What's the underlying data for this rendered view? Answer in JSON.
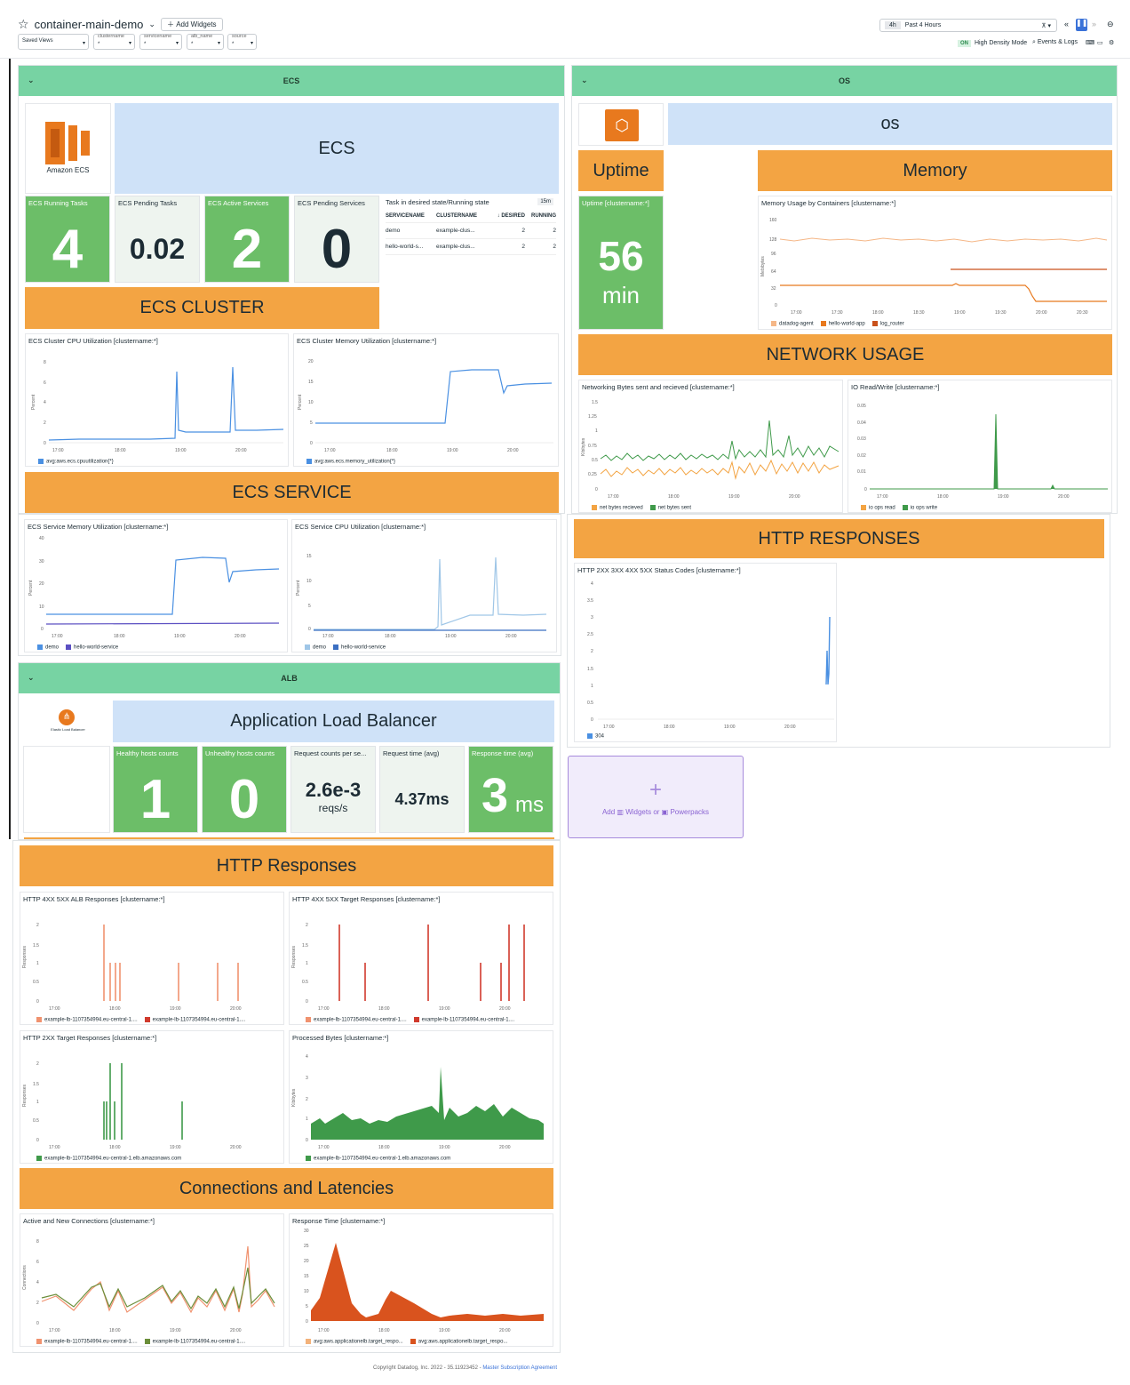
{
  "header": {
    "dashboard_title": "container-main-demo",
    "add_widgets": "Add Widgets",
    "saved_views": "Saved Views",
    "vars": [
      {
        "name": "clustername",
        "value": "*"
      },
      {
        "name": "servicename",
        "value": "*"
      },
      {
        "name": "alb_name",
        "value": "*"
      },
      {
        "name": "source",
        "value": "*"
      }
    ],
    "time_short": "4h",
    "time_label": "Past 4 Hours",
    "on_badge": "ON",
    "high_density": "High Density Mode",
    "events_logs": "Events & Logs"
  },
  "ecs": {
    "group_title": "ECS",
    "logo_text": "Amazon ECS",
    "note": "ECS",
    "running_tasks_title": "ECS Running Tasks",
    "running_tasks": "4",
    "pending_tasks_title": "ECS Pending Tasks",
    "pending_tasks": "0.02",
    "active_services_title": "ECS Active Services",
    "active_services": "2",
    "pending_services_title": "ECS Pending Services",
    "pending_services": "0",
    "table": {
      "title": "Task in desired state/Running state",
      "badge": "15m",
      "headers": [
        "SERVICENAME",
        "CLUSTERNAME",
        "DESIRED",
        "RUNNING"
      ],
      "rows": [
        [
          "demo",
          "example-clus...",
          "2",
          "2"
        ],
        [
          "hello-world-s...",
          "example-clus...",
          "2",
          "2"
        ]
      ]
    },
    "cluster_title": "ECS CLUSTER",
    "cpu_title": "ECS Cluster CPU Utilization [clustername:*]",
    "cpu_legend": "avg:aws.ecs.cpuutilization{*}",
    "mem_title": "ECS Cluster Memory Utilization [clustername:*]",
    "mem_legend": "avg:aws.ecs.memory_utilization{*}",
    "service_title": "ECS SERVICE",
    "svc_mem_title": "ECS Service Memory Utilization [clustername:*]",
    "svc_cpu_title": "ECS Service CPU Utilization [clustername:*]",
    "legend_demo": "demo",
    "legend_hello": "hello-world-service",
    "y_percent": "Percent"
  },
  "os": {
    "group_title": "OS",
    "note": "os",
    "uptime_title": "Uptime",
    "uptime_widget_title": "Uptime [clustername:*]",
    "uptime_value": "56",
    "uptime_unit": "min",
    "memory_title": "Memory",
    "mem_widget_title": "Memory Usage by Containers [clustername:*]",
    "mem_legend": [
      "datadog-agent",
      "hello-world-app",
      "log_router"
    ],
    "y_mebibytes": "Mebibytes",
    "network_title": "NETWORK USAGE",
    "net_widget_title": "Networking Bytes sent and recieved [clustername:*]",
    "net_legend": [
      "net bytes recieved",
      "net bytes sent"
    ],
    "y_kibibytes": "Kibibytes",
    "io_widget_title": "IO Read/Write [clustername:*]",
    "io_legend": [
      "io ops read",
      "io ops write"
    ],
    "http_title": "HTTP RESPONSES",
    "http_widget_title": "HTTP 2XX 3XX 4XX 5XX Status Codes [clustername:*]",
    "http_legend": "304"
  },
  "alb": {
    "group_title": "ALB",
    "logo_text": "Elastic Load Balancer",
    "note": "Application Load Balancer",
    "healthy_title": "Healthy hosts counts",
    "healthy": "1",
    "unhealthy_title": "Unhealthy hosts counts",
    "unhealthy": "0",
    "req_title": "Request counts per se...",
    "req_value": "2.6e-3",
    "req_unit": "reqs/s",
    "reqtime_title": "Request time (avg)",
    "reqtime_value": "4.37ms",
    "resp_title": "Response time (avg)",
    "resp_value": "3",
    "resp_unit": "ms",
    "http_title": "HTTP Responses",
    "w1_title": "HTTP 4XX 5XX ALB Responses [clustername:*]",
    "w2_title": "HTTP 4XX 5XX Target Responses [clustername:*]",
    "w3_title": "HTTP 2XX Target Responses [clustername:*]",
    "w4_title": "Processed Bytes [clustername:*]",
    "lb_short": "example-lb-1107354994.eu-central-1....",
    "lb_full": "example-lb-1107354994.eu-central-1.elb.amazonaws.com",
    "y_responses": "Responses",
    "y_kibibytes": "Kibibytes",
    "conn_title": "Connections and Latencies",
    "w5_title": "Active and New Connections [clustername:*]",
    "w6_title": "Response Time [clustername:*]",
    "y_connections": "Connections",
    "rt_legend": [
      "avg:aws.applicationelb.target_respo...",
      "avg:aws.applicationelb.target_respo..."
    ]
  },
  "add_widgets": {
    "add": "Add",
    "widgets": "Widgets or",
    "powerpacks": "Powerpacks"
  },
  "footer": {
    "text": "Copyright Datadog, Inc. 2022 - 35.11923452 -",
    "link": "Master Subscription Agreement"
  },
  "colors": {
    "green_header": "#77d3a3",
    "orange": "#f3a443",
    "note_blue": "#cfe2f8",
    "value_green": "#6cbe68"
  }
}
